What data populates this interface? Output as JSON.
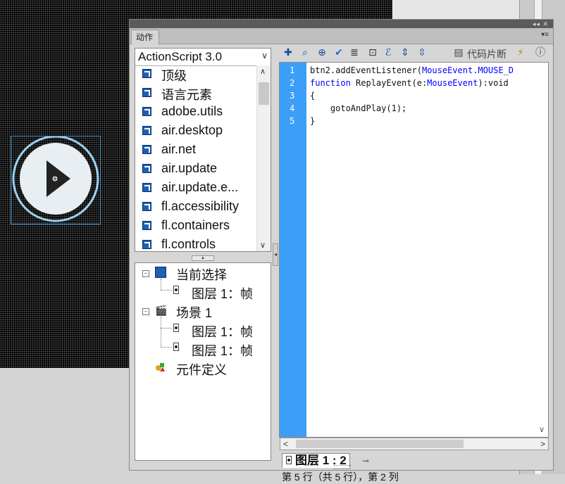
{
  "panel": {
    "tab_label": "动作",
    "collapse_icon": "double-chevron-icon",
    "menu_icon": "panel-menu-icon"
  },
  "script_version": "ActionScript 3.0",
  "packages": [
    "顶级",
    "语言元素",
    "adobe.utils",
    "air.desktop",
    "air.net",
    "air.update",
    "air.update.e...",
    "fl.accessibility",
    "fl.containers",
    "fl.controls"
  ],
  "tree": {
    "current_selection": "当前选择",
    "current_frame": "图层 1：帧",
    "scene": "场景 1",
    "scene_frame_1": "图层 1：帧",
    "scene_frame_2": "图层 1：帧",
    "symbol_defs": "元件定义"
  },
  "toolbar": {
    "code_snippets_label": "代码片断",
    "icons": [
      "add-script-icon",
      "find-icon",
      "target-icon",
      "check-syntax-icon",
      "auto-format-icon",
      "code-hint-icon",
      "debug-icon",
      "collapse-between-braces-icon",
      "collapse-selection-icon",
      "code-snippets-icon",
      "wizard-icon",
      "help-icon"
    ]
  },
  "code": {
    "line_numbers": [
      "1",
      "2",
      "3",
      "4",
      "5"
    ],
    "lines": [
      {
        "p1": "btn2.addEventListener(",
        "p2": "MouseEvent",
        "p3": ".MOUSE_D"
      },
      {
        "p1": "function",
        "p2": " ReplayEvent(e:",
        "p3": "MouseEvent",
        "p4": "):void"
      },
      {
        "p1": "{"
      },
      {
        "p1": "    gotoAndPlay(1);"
      },
      {
        "p1": "}"
      }
    ]
  },
  "layer_tab": "图层 1 : 2",
  "status_text": "第 5 行（共 5 行），第 2 列",
  "colors": {
    "gutter": "#3d9ef8",
    "keyword": "#0000ff",
    "accent": "#4a9ad8"
  }
}
